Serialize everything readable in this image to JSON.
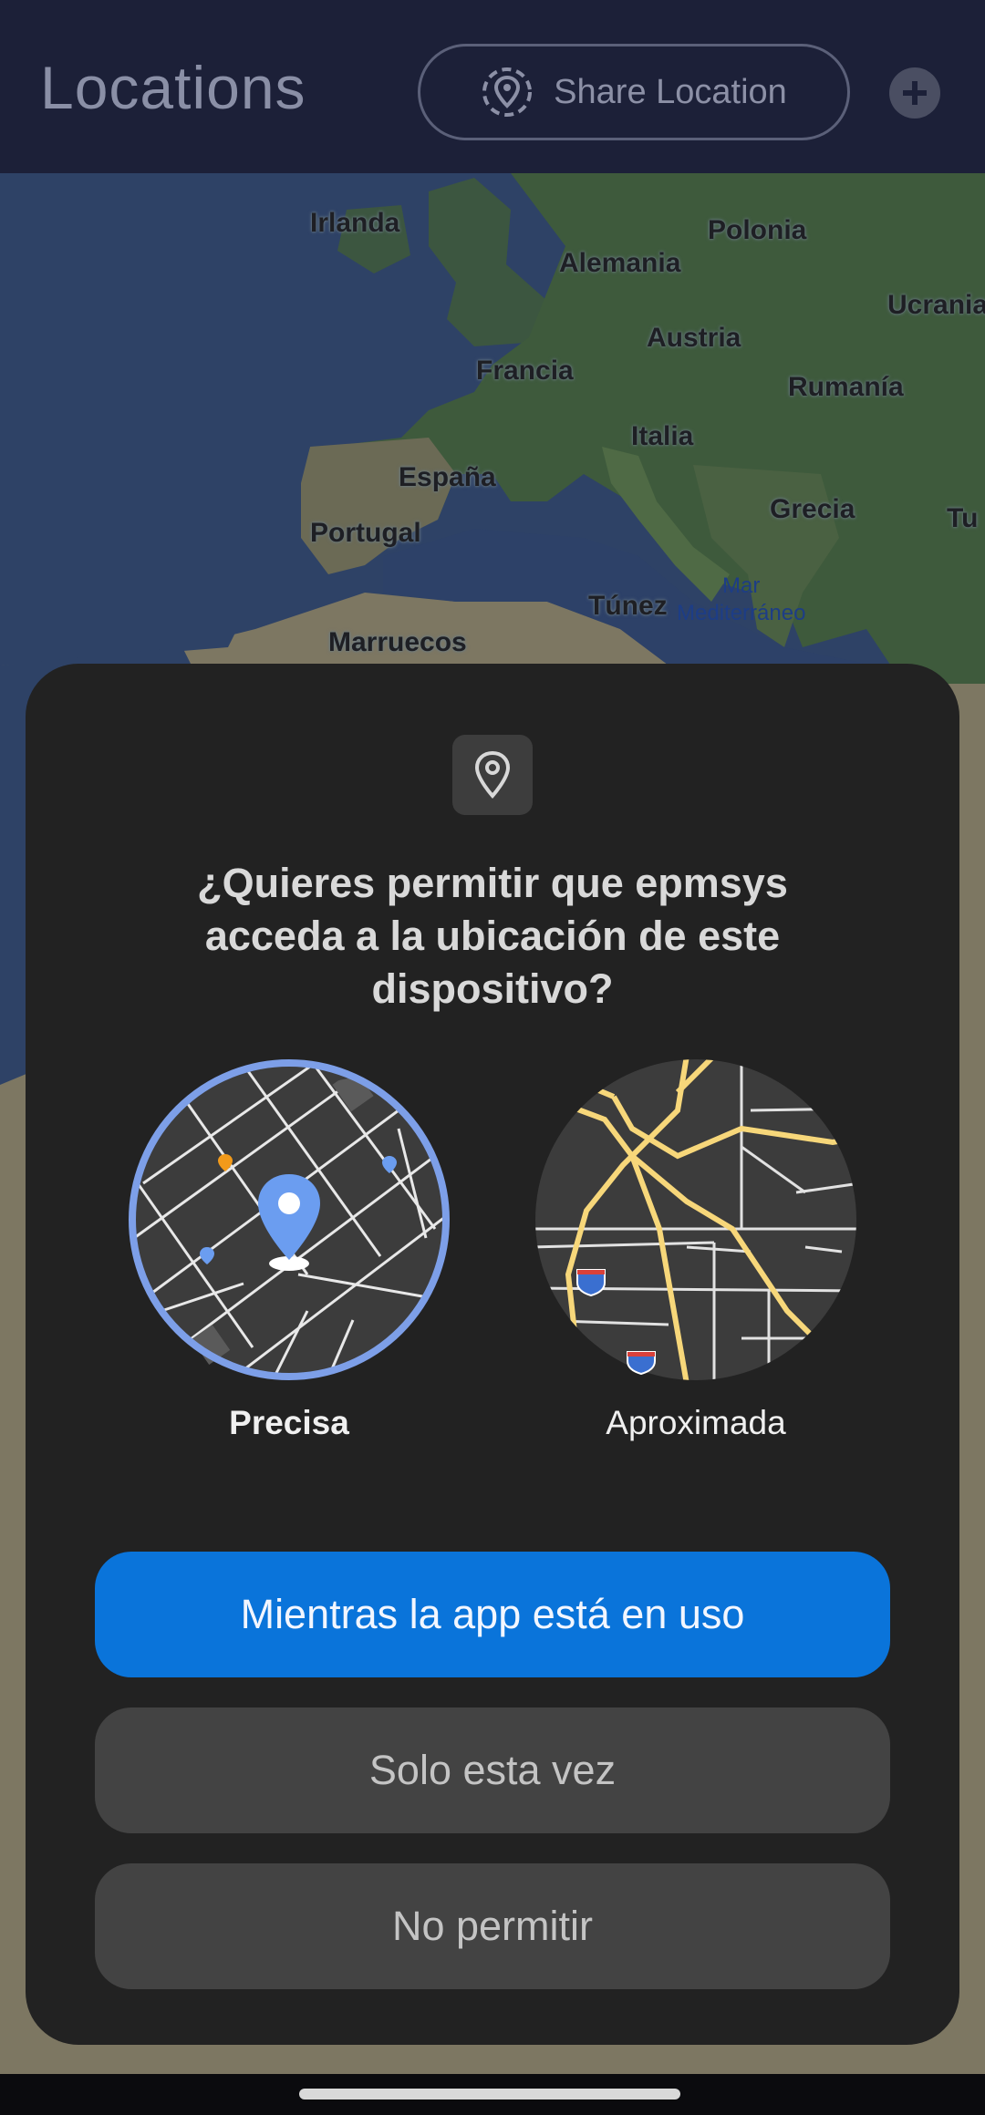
{
  "appbar": {
    "title": "Locations",
    "share_label": "Share Location",
    "share_icon": "location-target-icon",
    "add_icon": "plus-circle-icon"
  },
  "map": {
    "labels": {
      "irlanda": "Irlanda",
      "alemania": "Alemania",
      "polonia": "Polonia",
      "ucrania": "Ucrania",
      "austria": "Austria",
      "francia": "Francia",
      "rumania": "Rumanía",
      "italia": "Italia",
      "espana": "España",
      "portugal": "Portugal",
      "grecia": "Grecia",
      "turquia": "Tu",
      "tunez": "Túnez",
      "marruecos": "Marruecos"
    },
    "sea_line1": "Mar",
    "sea_line2": "Mediterráneo"
  },
  "dialog": {
    "icon": "location-pin-icon",
    "title": "¿Quieres permitir que epmsys acceda a la ubicación de este dispositivo?",
    "option_precise": "Precisa",
    "option_approx": "Aproximada",
    "selected_option": "Precisa",
    "btn_while_using": "Mientras la app está en uso",
    "btn_only_once": "Solo esta vez",
    "btn_deny": "No permitir"
  },
  "colors": {
    "primary_button": "#0a74da",
    "dialog_bg": "#222222",
    "appbar_bg": "#1c2038",
    "precise_ring": "#7d9fe8",
    "road_yellow": "#f7d77a"
  }
}
